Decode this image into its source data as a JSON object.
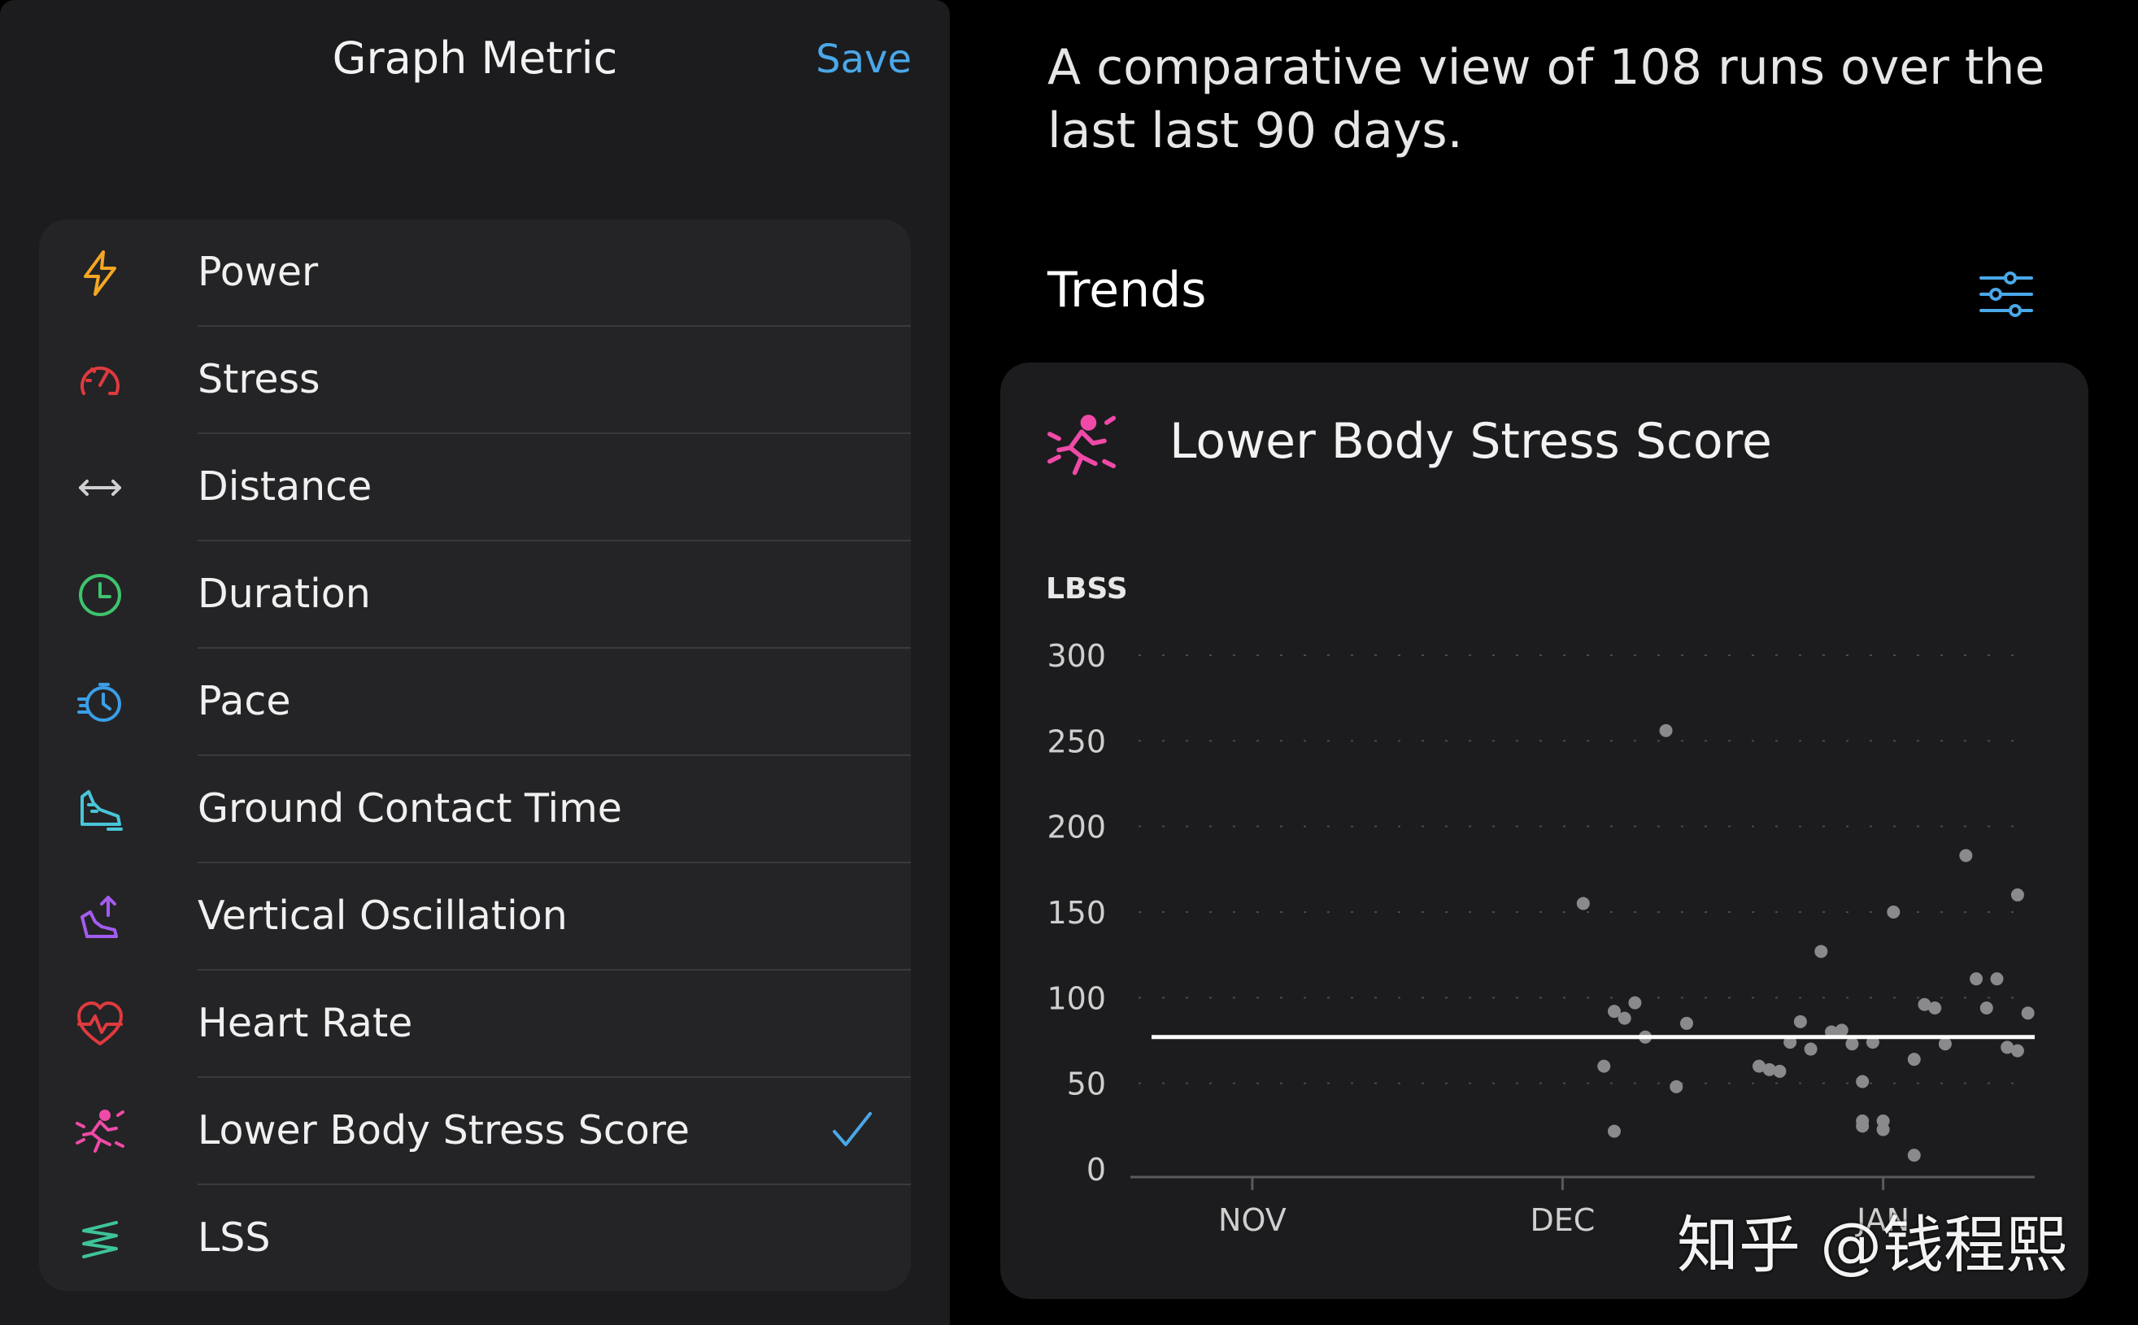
{
  "header": {
    "title": "Graph Metric",
    "save_label": "Save"
  },
  "metrics": [
    {
      "label": "Power",
      "icon": "lightning-icon",
      "color": "#f5a623",
      "selected": false
    },
    {
      "label": "Stress",
      "icon": "gauge-icon",
      "color": "#e03a3e",
      "selected": false
    },
    {
      "label": "Distance",
      "icon": "double-arrow-icon",
      "color": "#d0d0d0",
      "selected": false
    },
    {
      "label": "Duration",
      "icon": "clock-icon",
      "color": "#3ec46d",
      "selected": false
    },
    {
      "label": "Pace",
      "icon": "stopwatch-icon",
      "color": "#3a9fe8",
      "selected": false
    },
    {
      "label": "Ground Contact Time",
      "icon": "shoe-icon",
      "color": "#48c6d8",
      "selected": false
    },
    {
      "label": "Vertical Oscillation",
      "icon": "shoe-up-icon",
      "color": "#a45cf0",
      "selected": false
    },
    {
      "label": "Heart Rate",
      "icon": "heart-pulse-icon",
      "color": "#e03a3e",
      "selected": true
    },
    {
      "label": "Lower Body Stress Score",
      "icon": "runner-impact-icon",
      "color": "#f04aa8",
      "selected": true
    },
    {
      "label": "LSS",
      "icon": "spring-icon",
      "color": "#3ec49a",
      "selected": false
    }
  ],
  "selected_metric": "Lower Body Stress Score",
  "summary": "A comparative view of 108 runs over the last last 90 days.",
  "trends": {
    "title": "Trends",
    "filter_icon": "sliders-icon",
    "accent": "#4aa8e8"
  },
  "card": {
    "title": "Lower Body Stress Score",
    "icon": "runner-impact-icon",
    "icon_color": "#f04aa8"
  },
  "chart_data": {
    "type": "scatter",
    "ylabel": "LBSS",
    "ylim": [
      0,
      300
    ],
    "yticks": [
      0,
      50,
      100,
      150,
      200,
      250,
      300
    ],
    "xticks": [
      "NOV",
      "DEC",
      "JAN"
    ],
    "grid": true,
    "average_line": 77,
    "points": [
      {
        "x": "2023-12-03",
        "y": 155
      },
      {
        "x": "2023-12-05",
        "y": 60
      },
      {
        "x": "2023-12-06",
        "y": 92
      },
      {
        "x": "2023-12-06",
        "y": 22
      },
      {
        "x": "2023-12-07",
        "y": 88
      },
      {
        "x": "2023-12-08",
        "y": 97
      },
      {
        "x": "2023-12-09",
        "y": 77
      },
      {
        "x": "2023-12-11",
        "y": 256
      },
      {
        "x": "2023-12-12",
        "y": 48
      },
      {
        "x": "2023-12-13",
        "y": 85
      },
      {
        "x": "2023-12-20",
        "y": 60
      },
      {
        "x": "2023-12-21",
        "y": 58
      },
      {
        "x": "2023-12-22",
        "y": 57
      },
      {
        "x": "2023-12-23",
        "y": 74
      },
      {
        "x": "2023-12-24",
        "y": 86
      },
      {
        "x": "2023-12-25",
        "y": 70
      },
      {
        "x": "2023-12-26",
        "y": 127
      },
      {
        "x": "2023-12-27",
        "y": 80
      },
      {
        "x": "2023-12-28",
        "y": 81
      },
      {
        "x": "2023-12-29",
        "y": 73
      },
      {
        "x": "2023-12-30",
        "y": 51
      },
      {
        "x": "2023-12-30",
        "y": 28
      },
      {
        "x": "2023-12-30",
        "y": 25
      },
      {
        "x": "2023-12-31",
        "y": 74
      },
      {
        "x": "2024-01-01",
        "y": 28
      },
      {
        "x": "2024-01-01",
        "y": 23
      },
      {
        "x": "2024-01-02",
        "y": 150
      },
      {
        "x": "2024-01-04",
        "y": 64
      },
      {
        "x": "2024-01-04",
        "y": 8
      },
      {
        "x": "2024-01-05",
        "y": 96
      },
      {
        "x": "2024-01-06",
        "y": 94
      },
      {
        "x": "2024-01-07",
        "y": 73
      },
      {
        "x": "2024-01-09",
        "y": 183
      },
      {
        "x": "2024-01-10",
        "y": 111
      },
      {
        "x": "2024-01-11",
        "y": 94
      },
      {
        "x": "2024-01-12",
        "y": 111
      },
      {
        "x": "2024-01-13",
        "y": 71
      },
      {
        "x": "2024-01-14",
        "y": 160
      },
      {
        "x": "2024-01-14",
        "y": 69
      },
      {
        "x": "2024-01-15",
        "y": 91
      }
    ]
  },
  "watermark": "知乎 @钱程熙"
}
